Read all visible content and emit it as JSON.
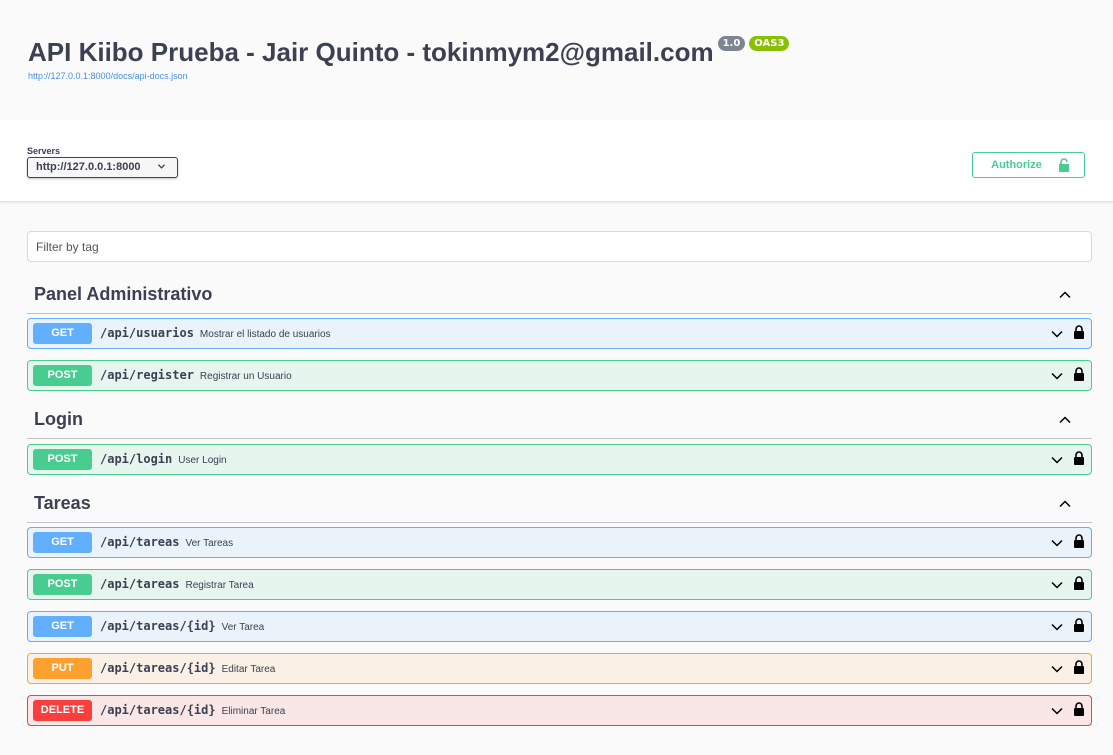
{
  "info": {
    "title": "API Kiibo Prueba - Jair Quinto - tokinmym2@gmail.com",
    "version_badge": "1.0",
    "oas_badge": "OAS3",
    "spec_link": "http://127.0.0.1:8000/docs/api-docs.json"
  },
  "servers": {
    "label": "Servers",
    "selected": "http://127.0.0.1:8000"
  },
  "authorize": {
    "label": "Authorize"
  },
  "filter": {
    "placeholder": "Filter by tag"
  },
  "tags": [
    {
      "name": "Panel Administrativo"
    },
    {
      "name": "Login"
    },
    {
      "name": "Tareas"
    }
  ],
  "operations": [
    {
      "method": "GET",
      "path": "/api/usuarios",
      "summary": "Mostrar el listado de usuarios"
    },
    {
      "method": "POST",
      "path": "/api/register",
      "summary": "Registrar un Usuario"
    },
    {
      "method": "POST",
      "path": "/api/login",
      "summary": "User Login"
    },
    {
      "method": "GET",
      "path": "/api/tareas",
      "summary": "Ver Tareas"
    },
    {
      "method": "POST",
      "path": "/api/tareas",
      "summary": "Registrar Tarea"
    },
    {
      "method": "GET",
      "path": "/api/tareas/{id}",
      "summary": "Ver Tarea"
    },
    {
      "method": "PUT",
      "path": "/api/tareas/{id}",
      "summary": "Editar Tarea"
    },
    {
      "method": "DELETE",
      "path": "/api/tareas/{id}",
      "summary": "Eliminar Tarea"
    }
  ],
  "colors": {
    "get": "#61affe",
    "post": "#49cc90",
    "put": "#fca130",
    "delete": "#f93e3e",
    "version_badge": "#7d8492",
    "oas_badge": "#89bf04",
    "link": "#4990e2"
  },
  "icons": {
    "tag_toggle": "chevron-up-icon",
    "op_toggle": "chevron-down-icon",
    "op_lock": "lock-icon",
    "authorize": "unlocked-icon",
    "servers_dropdown": "chevron-down-icon"
  }
}
